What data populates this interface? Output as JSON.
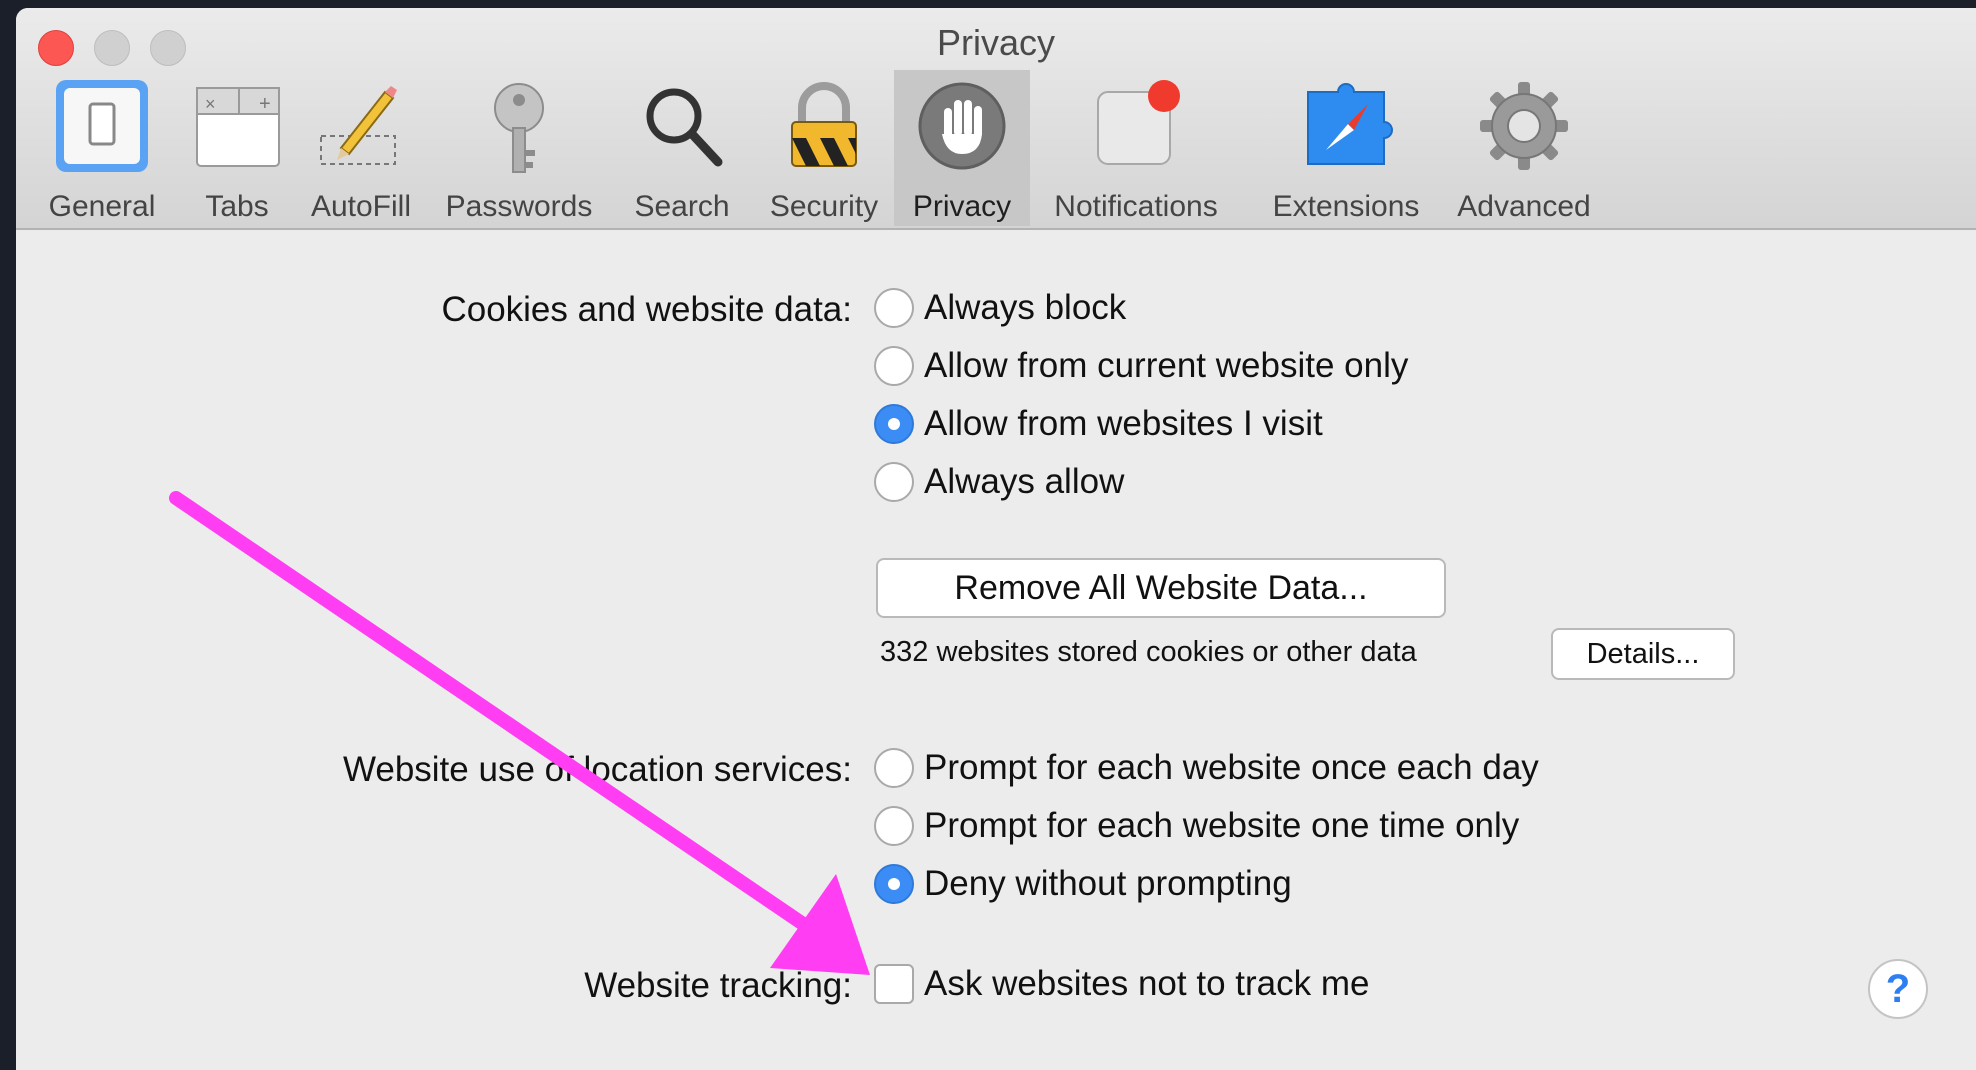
{
  "window": {
    "title": "Privacy"
  },
  "toolbar": {
    "items": [
      {
        "label": "General",
        "icon": "general-switch-icon"
      },
      {
        "label": "Tabs",
        "icon": "tabs-icon"
      },
      {
        "label": "AutoFill",
        "icon": "pencil-icon"
      },
      {
        "label": "Passwords",
        "icon": "key-icon"
      },
      {
        "label": "Search",
        "icon": "magnifier-icon"
      },
      {
        "label": "Security",
        "icon": "padlock-icon"
      },
      {
        "label": "Privacy",
        "icon": "hand-icon",
        "selected": true
      },
      {
        "label": "Notifications",
        "icon": "notification-badge-icon"
      },
      {
        "label": "Extensions",
        "icon": "puzzle-compass-icon"
      },
      {
        "label": "Advanced",
        "icon": "gear-icon"
      }
    ]
  },
  "cookies": {
    "label": "Cookies and website data:",
    "options": [
      {
        "label": "Always block",
        "checked": false
      },
      {
        "label": "Allow from current website only",
        "checked": false
      },
      {
        "label": "Allow from websites I visit",
        "checked": true
      },
      {
        "label": "Always allow",
        "checked": false
      }
    ],
    "remove_button": "Remove All Website Data...",
    "stored_info": "332 websites stored cookies or other data",
    "details_button": "Details..."
  },
  "location": {
    "label": "Website use of location services:",
    "options": [
      {
        "label": "Prompt for each website once each day",
        "checked": false
      },
      {
        "label": "Prompt for each website one time only",
        "checked": false
      },
      {
        "label": "Deny without prompting",
        "checked": true
      }
    ]
  },
  "tracking": {
    "label": "Website tracking:",
    "checkbox_label": "Ask websites not to track me",
    "checked": false
  },
  "help": {
    "label": "?"
  },
  "colors": {
    "annotation_arrow": "#ff3df2",
    "accent": "#3b8df5",
    "close": "#fc5753"
  }
}
